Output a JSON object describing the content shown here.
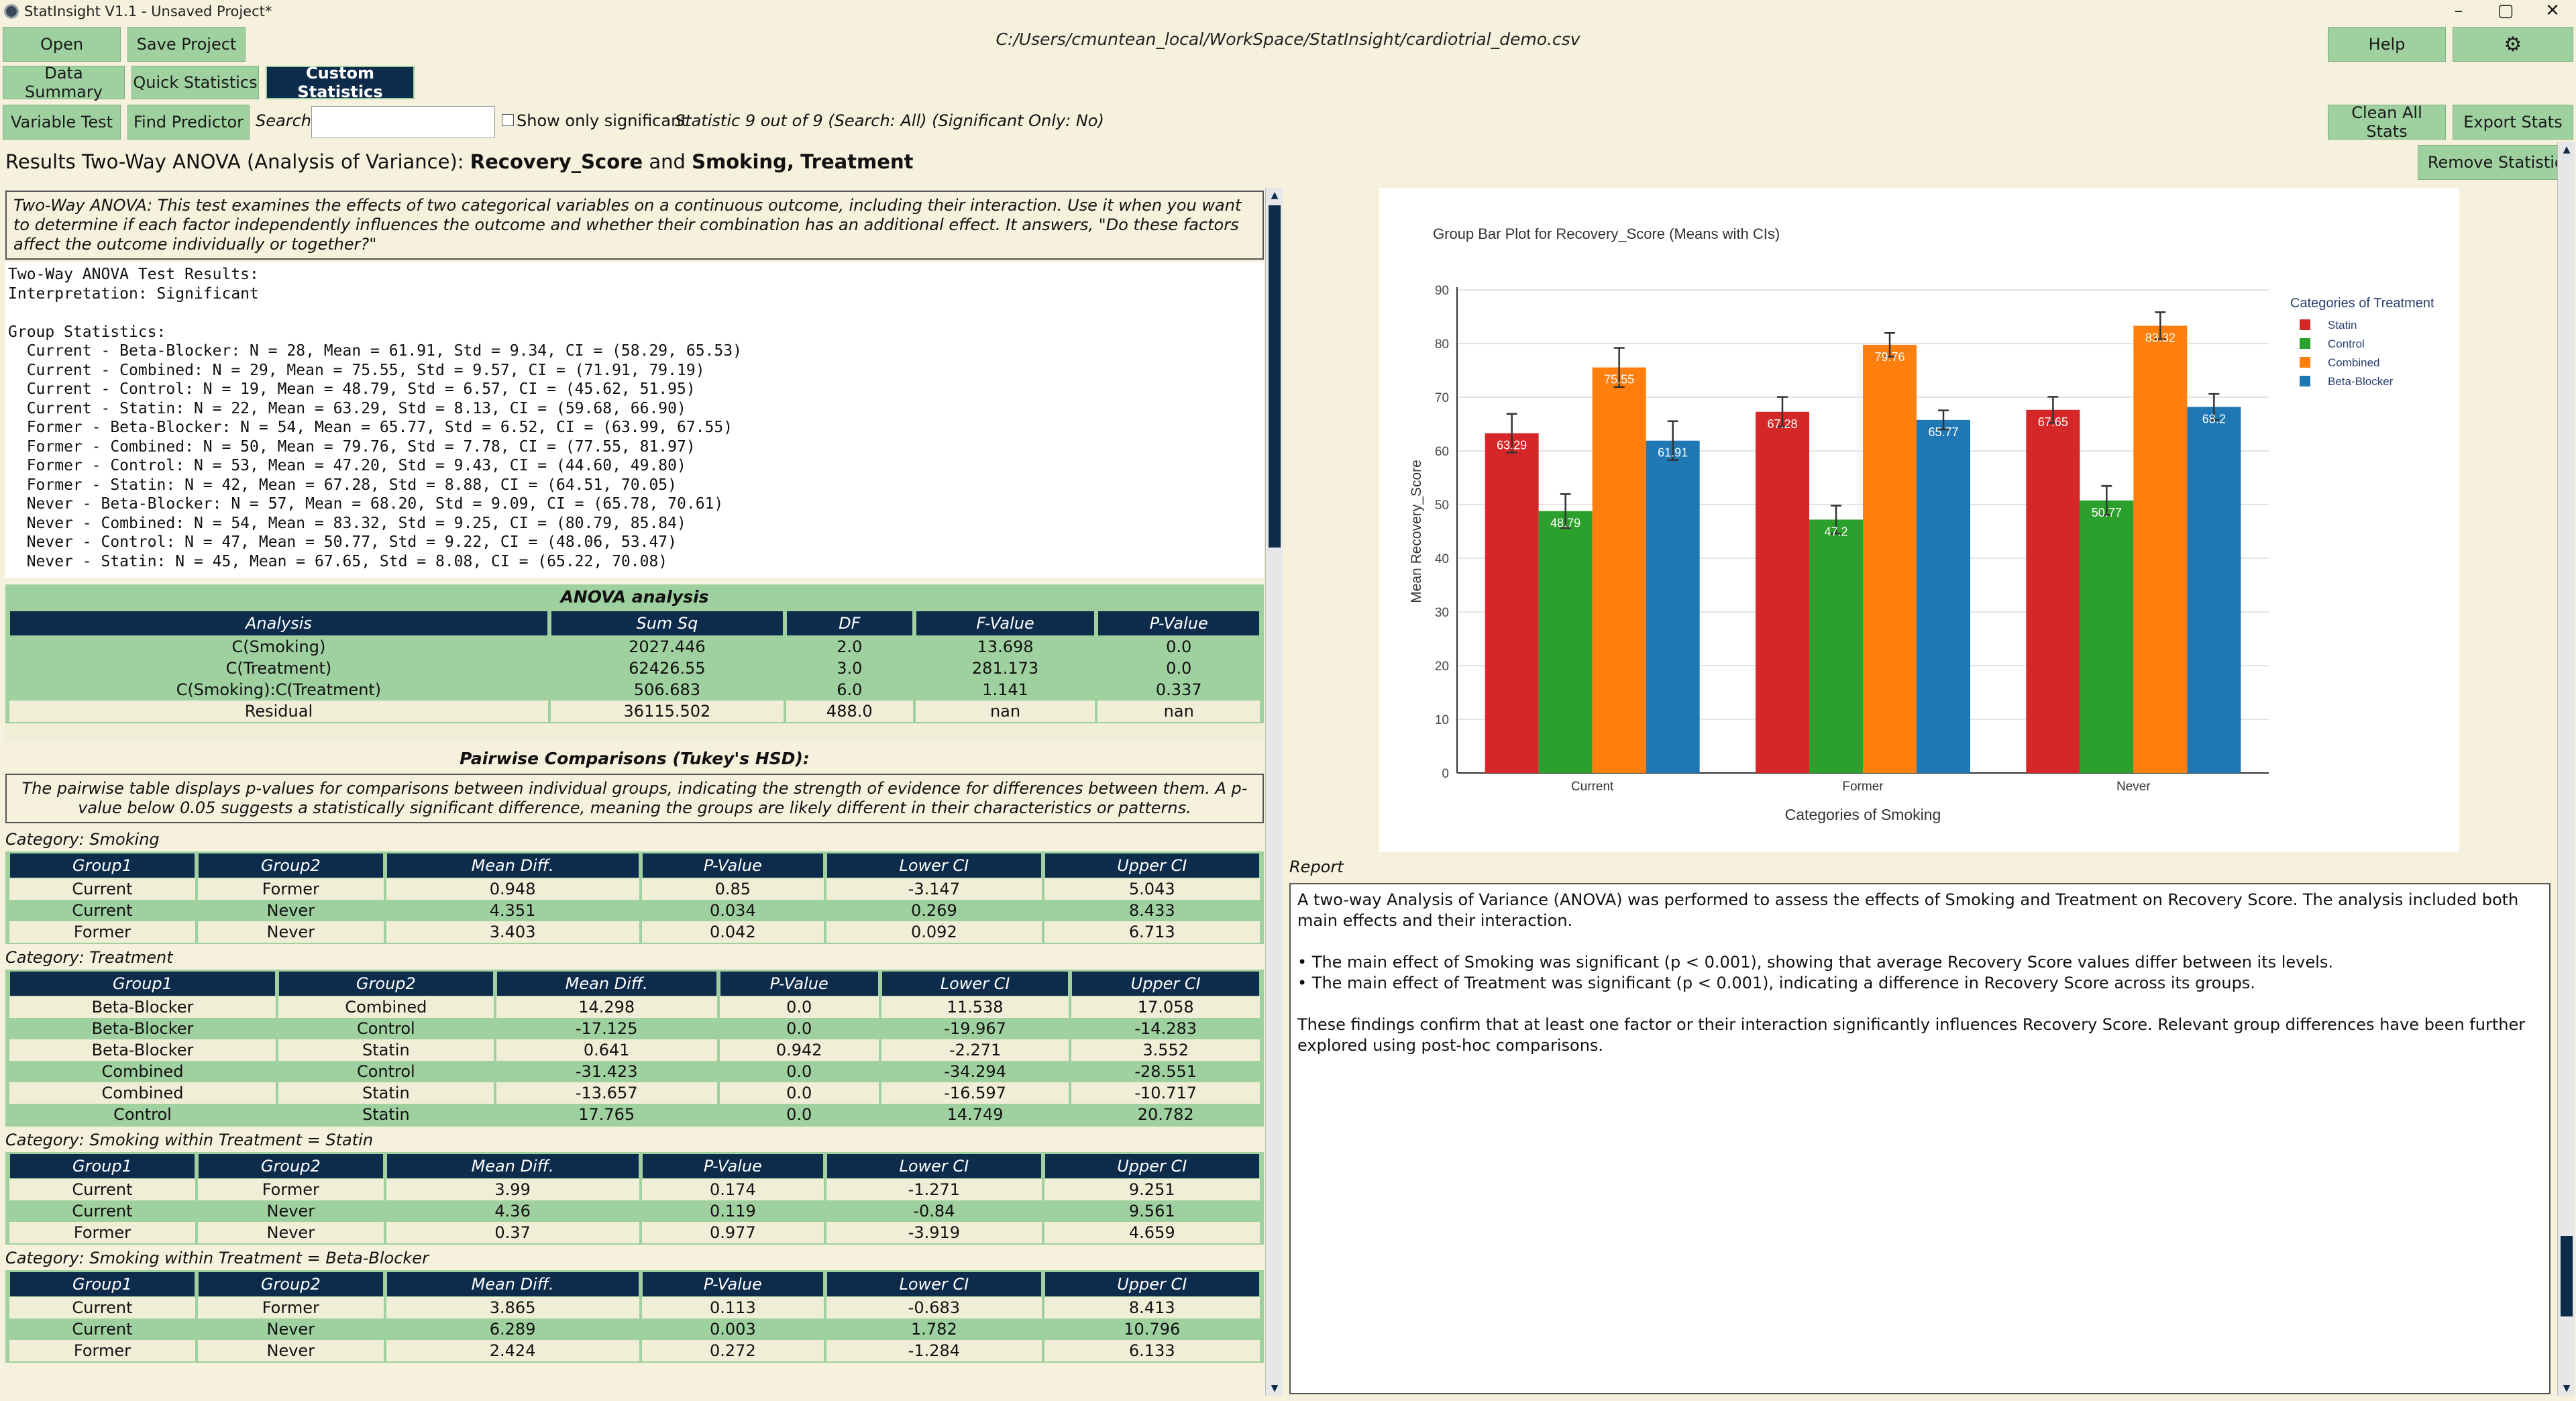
{
  "window": {
    "title": "StatInsight V1.1 - Unsaved Project*",
    "controls": [
      "–",
      "▢",
      "✕"
    ]
  },
  "toolbar": {
    "open": "Open",
    "save": "Save Project",
    "path": "C:/Users/cmuntean_local/WorkSpace/StatInsight/cardiotrial_demo.csv",
    "help": "Help",
    "settings_icon": "⚙"
  },
  "tabs": {
    "data_summary": "Data Summary",
    "quick_stats": "Quick Statistics",
    "custom_stats": "Custom Statistics"
  },
  "subbar": {
    "variable_test": "Variable Test",
    "find_predictor": "Find Predictor",
    "search_label": "Search:",
    "search_value": "",
    "show_sig": "Show only significant",
    "stat_info": "Statistic 9 out of 9 (Search: All) (Significant Only: No)",
    "clean_all": "Clean All Stats",
    "export": "Export Stats"
  },
  "results": {
    "title_prefix": "Results Two-Way ANOVA (Analysis of Variance):",
    "var1": "Recovery_Score",
    "and_word": "and",
    "var2": "Smoking",
    "sep": ",",
    "var3": "Treatment",
    "remove": "Remove Statistic"
  },
  "description": "Two-Way ANOVA: This test examines the effects of two categorical variables on a continuous outcome, including their interaction. Use it when you want to determine if each factor independently influences the outcome and whether their combination has an additional effect. It answers, \"Do these factors affect the outcome individually or together?\"",
  "test_output": "Two-Way ANOVA Test Results:\nInterpretation: Significant\n\nGroup Statistics:\n  Current - Beta-Blocker: N = 28, Mean = 61.91, Std = 9.34, CI = (58.29, 65.53)\n  Current - Combined: N = 29, Mean = 75.55, Std = 9.57, CI = (71.91, 79.19)\n  Current - Control: N = 19, Mean = 48.79, Std = 6.57, CI = (45.62, 51.95)\n  Current - Statin: N = 22, Mean = 63.29, Std = 8.13, CI = (59.68, 66.90)\n  Former - Beta-Blocker: N = 54, Mean = 65.77, Std = 6.52, CI = (63.99, 67.55)\n  Former - Combined: N = 50, Mean = 79.76, Std = 7.78, CI = (77.55, 81.97)\n  Former - Control: N = 53, Mean = 47.20, Std = 9.43, CI = (44.60, 49.80)\n  Former - Statin: N = 42, Mean = 67.28, Std = 8.88, CI = (64.51, 70.05)\n  Never - Beta-Blocker: N = 57, Mean = 68.20, Std = 9.09, CI = (65.78, 70.61)\n  Never - Combined: N = 54, Mean = 83.32, Std = 9.25, CI = (80.79, 85.84)\n  Never - Control: N = 47, Mean = 50.77, Std = 9.22, CI = (48.06, 53.47)\n  Never - Statin: N = 45, Mean = 67.65, Std = 8.08, CI = (65.22, 70.08)",
  "anova": {
    "heading": "ANOVA analysis",
    "headers": [
      "Analysis",
      "Sum Sq",
      "DF",
      "F-Value",
      "P-Value"
    ],
    "rows": [
      [
        "C(Smoking)",
        "2027.446",
        "2.0",
        "13.698",
        "0.0"
      ],
      [
        "C(Treatment)",
        "62426.55",
        "3.0",
        "281.173",
        "0.0"
      ],
      [
        "C(Smoking):C(Treatment)",
        "506.683",
        "6.0",
        "1.141",
        "0.337"
      ],
      [
        "Residual",
        "36115.502",
        "488.0",
        "nan",
        "nan"
      ]
    ]
  },
  "pairwise": {
    "heading": "Pairwise Comparisons (Tukey's HSD):",
    "description": "The pairwise table displays p-values for comparisons between individual groups, indicating the strength of evidence for differences between them. A p-value below 0.05 suggests a statistically significant difference, meaning the groups are likely different in their characteristics or patterns.",
    "headers": [
      "Group1",
      "Group2",
      "Mean Diff.",
      "P-Value",
      "Lower CI",
      "Upper CI"
    ],
    "sections": [
      {
        "label": "Category: Smoking",
        "rows": [
          [
            "Current",
            "Former",
            "0.948",
            "0.85",
            "-3.147",
            "5.043"
          ],
          [
            "Current",
            "Never",
            "4.351",
            "0.034",
            "0.269",
            "8.433"
          ],
          [
            "Former",
            "Never",
            "3.403",
            "0.042",
            "0.092",
            "6.713"
          ]
        ]
      },
      {
        "label": "Category: Treatment",
        "rows": [
          [
            "Beta-Blocker",
            "Combined",
            "14.298",
            "0.0",
            "11.538",
            "17.058"
          ],
          [
            "Beta-Blocker",
            "Control",
            "-17.125",
            "0.0",
            "-19.967",
            "-14.283"
          ],
          [
            "Beta-Blocker",
            "Statin",
            "0.641",
            "0.942",
            "-2.271",
            "3.552"
          ],
          [
            "Combined",
            "Control",
            "-31.423",
            "0.0",
            "-34.294",
            "-28.551"
          ],
          [
            "Combined",
            "Statin",
            "-13.657",
            "0.0",
            "-16.597",
            "-10.717"
          ],
          [
            "Control",
            "Statin",
            "17.765",
            "0.0",
            "14.749",
            "20.782"
          ]
        ]
      },
      {
        "label": "Category: Smoking within Treatment = Statin",
        "rows": [
          [
            "Current",
            "Former",
            "3.99",
            "0.174",
            "-1.271",
            "9.251"
          ],
          [
            "Current",
            "Never",
            "4.36",
            "0.119",
            "-0.84",
            "9.561"
          ],
          [
            "Former",
            "Never",
            "0.37",
            "0.977",
            "-3.919",
            "4.659"
          ]
        ]
      },
      {
        "label": "Category: Smoking within Treatment = Beta-Blocker",
        "rows": [
          [
            "Current",
            "Former",
            "3.865",
            "0.113",
            "-0.683",
            "8.413"
          ],
          [
            "Current",
            "Never",
            "6.289",
            "0.003",
            "1.782",
            "10.796"
          ],
          [
            "Former",
            "Never",
            "2.424",
            "0.272",
            "-1.284",
            "6.133"
          ]
        ]
      }
    ]
  },
  "chart_data": {
    "type": "bar",
    "title": "Group Bar Plot for Recovery_Score (Means with CIs)",
    "xlabel": "Categories of Smoking",
    "ylabel": "Mean Recovery_Score",
    "ylim": [
      0,
      90
    ],
    "yticks": [
      0,
      10,
      20,
      30,
      40,
      50,
      60,
      70,
      80,
      90
    ],
    "grid": true,
    "legend_title": "Categories of  Treatment",
    "legend_position": "top-right",
    "categories": [
      "Current",
      "Former",
      "Never"
    ],
    "series": [
      {
        "name": "Statin",
        "color": "#d62728",
        "values": [
          63.29,
          67.28,
          67.65
        ],
        "ci_low": [
          59.68,
          64.51,
          65.22
        ],
        "ci_high": [
          66.9,
          70.05,
          70.08
        ]
      },
      {
        "name": "Control",
        "color": "#2ca02c",
        "values": [
          48.79,
          47.2,
          50.77
        ],
        "ci_low": [
          45.62,
          44.6,
          48.06
        ],
        "ci_high": [
          51.95,
          49.8,
          53.47
        ]
      },
      {
        "name": "Combined",
        "color": "#ff7f0e",
        "values": [
          75.55,
          79.76,
          83.32
        ],
        "ci_low": [
          71.91,
          77.55,
          80.79
        ],
        "ci_high": [
          79.19,
          81.97,
          85.84
        ]
      },
      {
        "name": "Beta-Blocker",
        "color": "#1f77b4",
        "values": [
          61.91,
          65.77,
          68.2
        ],
        "ci_low": [
          58.29,
          63.99,
          65.78
        ],
        "ci_high": [
          65.53,
          67.55,
          70.61
        ]
      }
    ]
  },
  "report": {
    "label": "Report",
    "p1": "A two-way Analysis of Variance (ANOVA) was performed to assess the effects of Smoking and Treatment on Recovery Score. The analysis included both main effects and their interaction.",
    "b1": "• The main effect of Smoking was significant (p < 0.001), showing that average Recovery Score values differ between its levels.",
    "b2": "• The main effect of Treatment was significant (p < 0.001), indicating a difference in Recovery Score across its groups.",
    "p2": "These findings confirm that at least one factor or their interaction significantly influences Recovery Score. Relevant group differences have been further explored using post-hoc comparisons."
  },
  "colors": {
    "accent_green": "#9fd09f",
    "navy": "#0d2b4a",
    "background": "#f5f1dc"
  }
}
